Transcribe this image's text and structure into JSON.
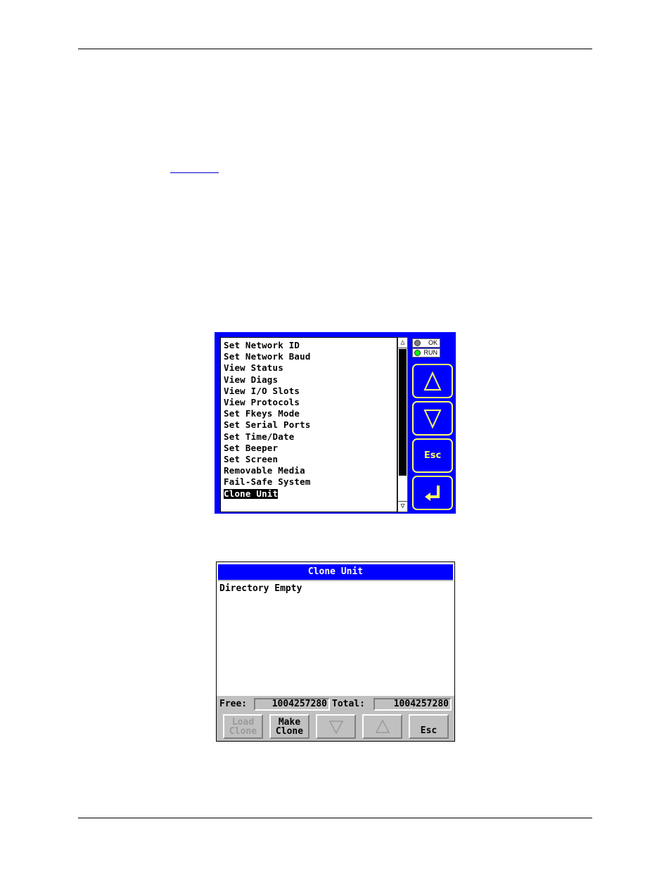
{
  "document": {
    "header_rule": true,
    "footer_rule": true
  },
  "screen1": {
    "menu_items": [
      "Set Network ID",
      "Set Network Baud",
      "View Status",
      "View Diags",
      "View I/O Slots",
      "View Protocols",
      "Set Fkeys Mode",
      "Set Serial Ports",
      "Set Time/Date",
      "Set Beeper",
      "Set Screen",
      "Removable Media",
      "Fail-Safe System",
      "Clone Unit"
    ],
    "selected_index": 13,
    "scrollbar": {
      "up_glyph": "△",
      "down_glyph": "▽"
    },
    "indicators": [
      {
        "label": "OK",
        "led_color": "#808080"
      },
      {
        "label": "RUN",
        "led_color": "#00ff00"
      }
    ],
    "buttons": {
      "up": "up-arrow",
      "down": "down-arrow",
      "esc": "Esc",
      "enter": "enter-arrow"
    },
    "colors": {
      "background": "#0000ff",
      "button_outline": "#ffff66"
    }
  },
  "screen2": {
    "title": "Clone Unit",
    "body_text": "Directory Empty",
    "free_label": "Free:",
    "free_value": "1004257280",
    "total_label": "Total:",
    "total_value": "1004257280",
    "buttons": {
      "load_line1": "Load",
      "load_line2": "Clone",
      "make_line1": "Make",
      "make_line2": "Clone",
      "esc": "Esc"
    },
    "colors": {
      "title_bar": "#0000ff",
      "panel": "#c0c0c0"
    }
  }
}
